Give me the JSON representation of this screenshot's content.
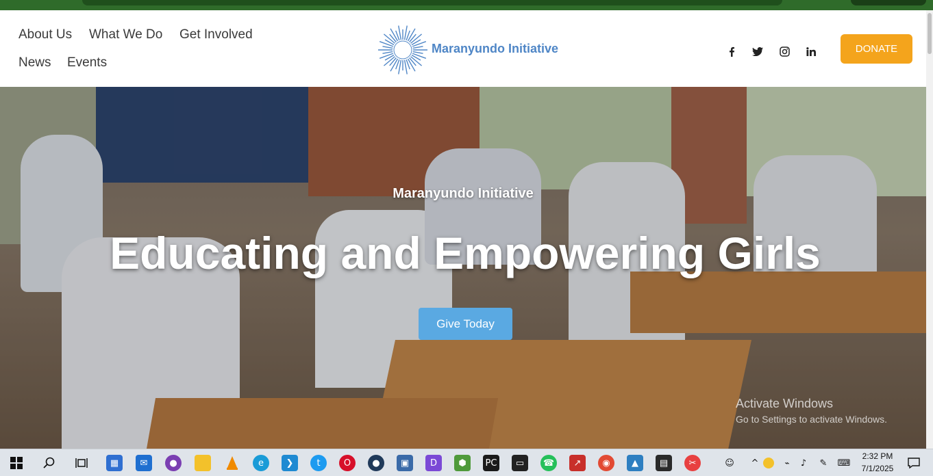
{
  "nav": {
    "items": [
      "About Us",
      "What We Do",
      "Get Involved",
      "News",
      "Events"
    ]
  },
  "logo": {
    "text": "Maranyundo Initiative"
  },
  "social": [
    "facebook-icon",
    "twitter-icon",
    "instagram-icon",
    "linkedin-icon"
  ],
  "donate_label": "DONATE",
  "hero": {
    "kicker": "Maranyundo Initiative",
    "title": "Educating and Empowering Girls",
    "cta": "Give Today"
  },
  "watermark": {
    "line1": "Activate Windows",
    "line2": "Go to Settings to activate Windows."
  },
  "taskbar": {
    "apps": [
      "start-icon",
      "search-icon",
      "task-view-icon",
      "store-icon",
      "mail-icon",
      "github-icon",
      "file-explorer-icon",
      "vlc-icon",
      "edge-icon",
      "vscode-icon",
      "twitter-icon",
      "opera-icon",
      "app-icon",
      "python-icon",
      "app-icon",
      "nodejs-icon",
      "pycharm-icon",
      "terminal-icon",
      "whatsapp-icon",
      "app-icon",
      "chrome-icon",
      "photos-icon",
      "video-editor-icon",
      "app-icon"
    ],
    "time": "2:32 PM",
    "date": "7/1/2025"
  },
  "colors": {
    "donate": "#f4a41c",
    "cta": "#5aa9e2",
    "logo": "#4f86c6",
    "browser": "#2f6b2a"
  }
}
